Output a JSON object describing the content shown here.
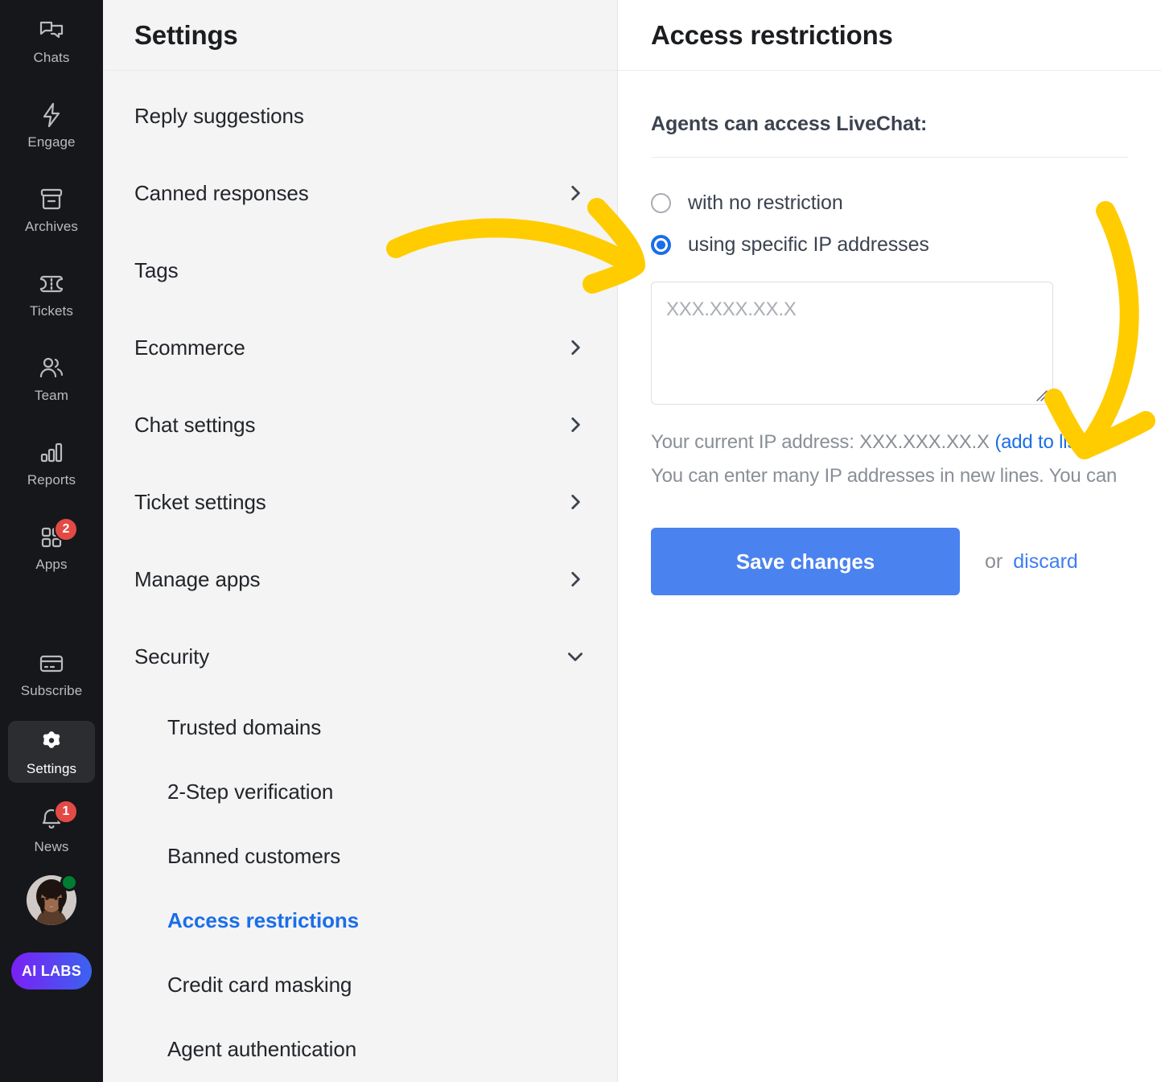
{
  "rail": {
    "items": [
      {
        "label": "Chats",
        "icon": "chats-icon",
        "badge": null,
        "active": false
      },
      {
        "label": "Engage",
        "icon": "engage-icon",
        "badge": null,
        "active": false
      },
      {
        "label": "Archives",
        "icon": "archives-icon",
        "badge": null,
        "active": false
      },
      {
        "label": "Tickets",
        "icon": "tickets-icon",
        "badge": null,
        "active": false
      },
      {
        "label": "Team",
        "icon": "team-icon",
        "badge": null,
        "active": false
      },
      {
        "label": "Reports",
        "icon": "reports-icon",
        "badge": null,
        "active": false
      },
      {
        "label": "Apps",
        "icon": "apps-icon",
        "badge": "2",
        "active": false
      },
      {
        "label": "Subscribe",
        "icon": "subscribe-icon",
        "badge": null,
        "active": false
      },
      {
        "label": "Settings",
        "icon": "gear-icon",
        "badge": null,
        "active": true
      },
      {
        "label": "News",
        "icon": "bell-icon",
        "badge": "1",
        "active": false
      }
    ],
    "ai_labs_label": "AI LABS",
    "presence_status": "online"
  },
  "settings_panel": {
    "title": "Settings",
    "items": [
      {
        "label": "Reply suggestions",
        "chevron": "none",
        "level": "top"
      },
      {
        "label": "Canned responses",
        "chevron": "right",
        "level": "top"
      },
      {
        "label": "Tags",
        "chevron": "none",
        "level": "top"
      },
      {
        "label": "Ecommerce",
        "chevron": "right",
        "level": "top"
      },
      {
        "label": "Chat settings",
        "chevron": "right",
        "level": "top"
      },
      {
        "label": "Ticket settings",
        "chevron": "right",
        "level": "top"
      },
      {
        "label": "Manage apps",
        "chevron": "right",
        "level": "top"
      },
      {
        "label": "Security",
        "chevron": "down",
        "level": "top"
      },
      {
        "label": "Trusted domains",
        "chevron": "none",
        "level": "sub"
      },
      {
        "label": "2-Step verification",
        "chevron": "none",
        "level": "sub"
      },
      {
        "label": "Banned customers",
        "chevron": "none",
        "level": "sub"
      },
      {
        "label": "Access restrictions",
        "chevron": "none",
        "level": "sub",
        "current": true
      },
      {
        "label": "Credit card masking",
        "chevron": "none",
        "level": "sub"
      },
      {
        "label": "Agent authentication",
        "chevron": "none",
        "level": "sub"
      }
    ]
  },
  "content": {
    "title": "Access restrictions",
    "section_title": "Agents can access LiveChat:",
    "options": [
      {
        "label": "with no restriction",
        "selected": false
      },
      {
        "label": "using specific IP addresses",
        "selected": true
      }
    ],
    "ip_textarea": {
      "value": "",
      "placeholder": "XXX.XXX.XX.X"
    },
    "current_ip_label": "Your current IP address:",
    "current_ip_value": "XXX.XXX.XX.X",
    "add_to_list_label": "(add to list)",
    "helper_text": "You can enter many IP addresses in new lines. You can",
    "save_label": "Save changes",
    "or_label": "or",
    "discard_label": "discard"
  },
  "colors": {
    "rail_bg": "#16171a",
    "rail_active_bg": "#2b2d31",
    "panel_bg": "#f4f4f4",
    "accent_blue": "#1a6ee8",
    "button_blue": "#4a82ef",
    "badge_red": "#e34a45",
    "presence_green": "#007d33",
    "annotation_yellow": "#ffcc00"
  }
}
